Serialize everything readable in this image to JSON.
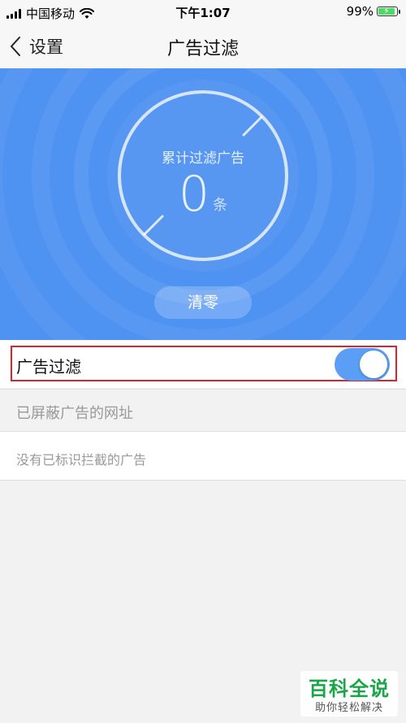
{
  "status_bar": {
    "carrier": "中国移动",
    "time": "下午1:07",
    "battery_percent": "99%",
    "battery_level": 0.99
  },
  "nav": {
    "back_label": "设置",
    "title": "广告过滤"
  },
  "hero": {
    "counter_label": "累计过滤广告",
    "counter_value": "0",
    "counter_unit": "条",
    "clear_button": "清零"
  },
  "toggle": {
    "label": "广告过滤",
    "state": "on"
  },
  "blocked_section": {
    "header": "已屏蔽广告的网址",
    "empty_text": "没有已标识拦截的广告"
  },
  "watermark": {
    "title": "百科全说",
    "subtitle": "助你轻松解决"
  },
  "colors": {
    "hero_blue": "#4e92f2",
    "switch_on": "#5a9ef5",
    "highlight_red": "#d7262f",
    "watermark_green": "#19a548"
  }
}
